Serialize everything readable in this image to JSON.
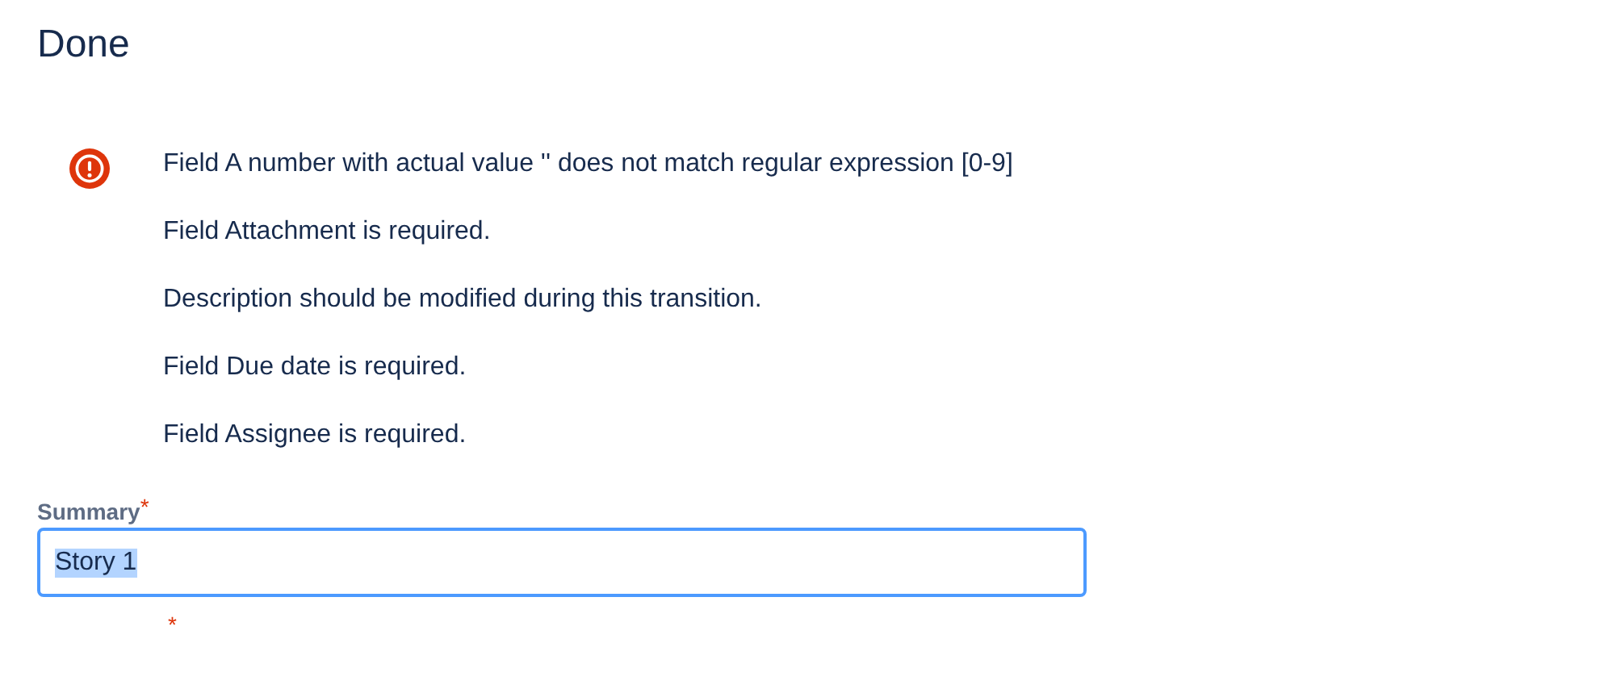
{
  "title": "Done",
  "errors": [
    "Field A number with actual value '' does not match regular expression [0-9]",
    "Field Attachment is required.",
    "Description should be modified during this transition.",
    "Field Due date is required.",
    "Field Assignee is required."
  ],
  "fields": [
    {
      "label": "Summary",
      "required_mark": "*",
      "value": "Story 1",
      "value_selected": true,
      "focused": true
    },
    {
      "required_mark": "*"
    }
  ]
}
